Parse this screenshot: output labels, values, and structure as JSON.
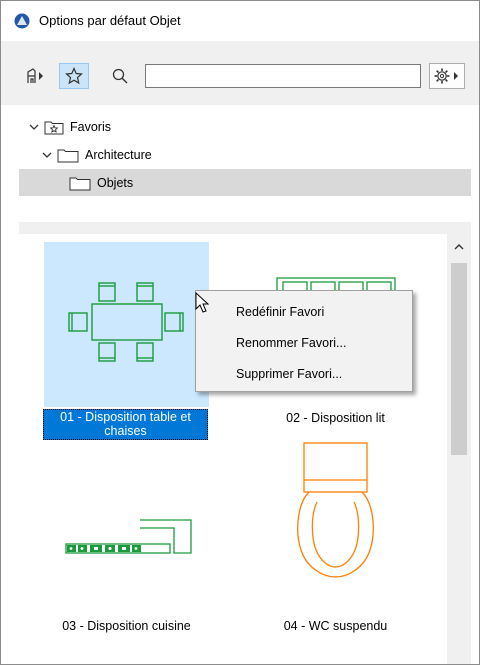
{
  "window": {
    "title": "Options par défaut Objet",
    "app_icon": "archicad-icon"
  },
  "toolbar": {
    "icons": [
      "library-icon",
      "star-icon",
      "search-icon",
      "settings-gear-icon"
    ],
    "search": {
      "value": "",
      "placeholder": ""
    }
  },
  "tree": {
    "items": [
      {
        "label": "Favoris",
        "icon": "favorites-folder-icon",
        "expanded": true
      },
      {
        "label": "Architecture",
        "icon": "folder-icon",
        "expanded": true
      },
      {
        "label": "Objets",
        "icon": "folder-icon",
        "selected": true
      }
    ]
  },
  "favorites": [
    {
      "label": "01 - Disposition table et chaises",
      "line1": "01 - Disposition table et",
      "line2": "chaises",
      "selected": true
    },
    {
      "label": "02 - Disposition lit"
    },
    {
      "label": "03 - Disposition cuisine"
    },
    {
      "label": "04 - WC suspendu"
    }
  ],
  "context_menu": {
    "items": [
      "Redéfinir Favori",
      "Renommer Favori...",
      "Supprimer Favori..."
    ]
  },
  "colors": {
    "selection": "#0078d7",
    "selection_light": "#cce8ff",
    "plan_green": "#1a9a3a",
    "plan_orange": "#ff7f00"
  }
}
